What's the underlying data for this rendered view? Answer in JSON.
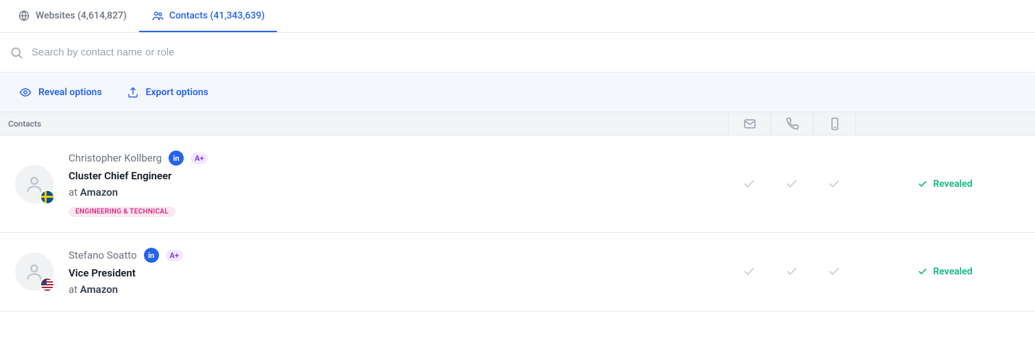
{
  "tabs": {
    "websites": {
      "label": "Websites (4,614,827)"
    },
    "contacts": {
      "label": "Contacts (41,343,639)"
    }
  },
  "search": {
    "placeholder": "Search by contact name or role"
  },
  "options": {
    "reveal": "Reveal options",
    "export": "Export options"
  },
  "table": {
    "header": "Contacts"
  },
  "rows": [
    {
      "name": "Christopher Kollberg",
      "grade": "A+",
      "title": "Cluster Chief Engineer",
      "at_prefix": "at ",
      "company": "Amazon",
      "tag": "ENGINEERING & TECHNICAL",
      "flag": "sweden",
      "status": "Revealed"
    },
    {
      "name": "Stefano Soatto",
      "grade": "A+",
      "title": "Vice President",
      "at_prefix": "at ",
      "company": "Amazon",
      "tag": "",
      "flag": "usa",
      "status": "Revealed"
    }
  ]
}
